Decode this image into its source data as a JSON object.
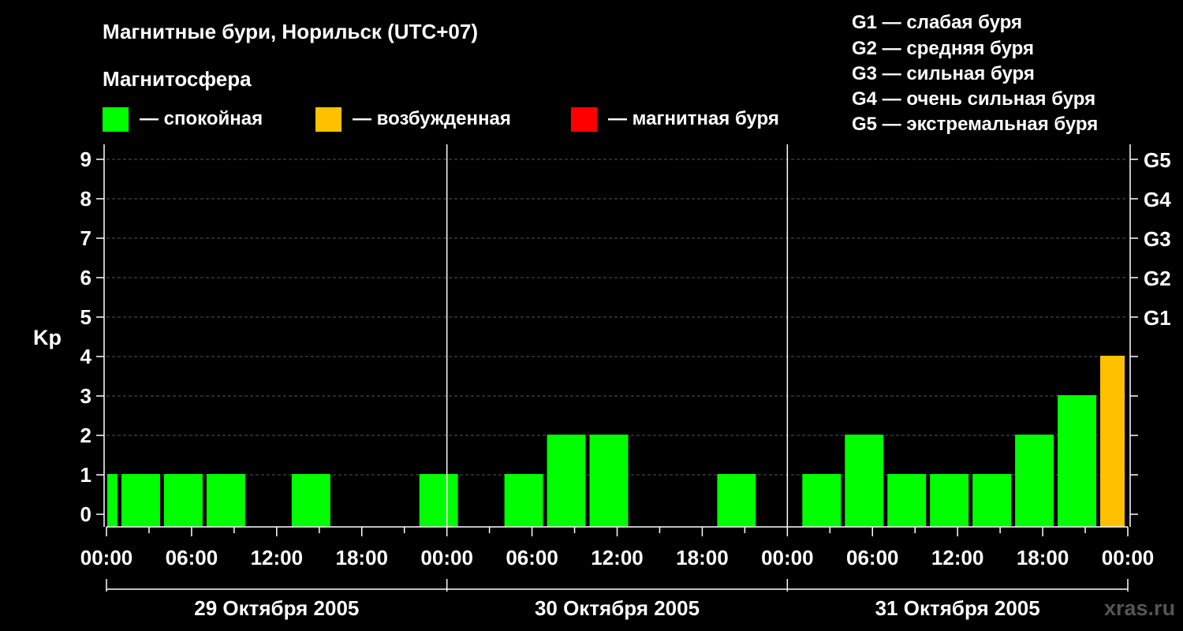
{
  "header": {
    "title": "Магнитные бури, Норильск (UTC+07)",
    "subtitle": "Магнитосфера"
  },
  "legend": {
    "items": [
      {
        "label": "— спокойная",
        "color": "#00ff00"
      },
      {
        "label": "— возбужденная",
        "color": "#ffc000"
      },
      {
        "label": "— магнитная буря",
        "color": "#ff0000"
      }
    ]
  },
  "g_legend": [
    "G1 — слабая буря",
    "G2 — средняя буря",
    "G3 — сильная буря",
    "G4 — очень сильная буря",
    "G5 — экстремальная буря"
  ],
  "watermark": "xras.ru",
  "colors": {
    "quiet": "#00ff00",
    "disturbed": "#ffc000",
    "storm": "#ff0000",
    "background": "#000000",
    "grid": "#555555"
  },
  "chart_data": {
    "type": "bar",
    "ylabel": "Kp",
    "ylim": [
      0,
      9
    ],
    "yticks": [
      "0",
      "1",
      "2",
      "3",
      "4",
      "5",
      "6",
      "7",
      "8",
      "9"
    ],
    "g_ticks": [
      {
        "kp": 5,
        "label": "G1"
      },
      {
        "kp": 6,
        "label": "G2"
      },
      {
        "kp": 7,
        "label": "G3"
      },
      {
        "kp": 8,
        "label": "G4"
      },
      {
        "kp": 9,
        "label": "G5"
      }
    ],
    "x_range_hours": [
      0,
      72
    ],
    "xticks": [
      {
        "hour": 0,
        "label": "00:00"
      },
      {
        "hour": 6,
        "label": "06:00"
      },
      {
        "hour": 12,
        "label": "12:00"
      },
      {
        "hour": 18,
        "label": "18:00"
      },
      {
        "hour": 24,
        "label": "00:00"
      },
      {
        "hour": 30,
        "label": "06:00"
      },
      {
        "hour": 36,
        "label": "12:00"
      },
      {
        "hour": 42,
        "label": "18:00"
      },
      {
        "hour": 48,
        "label": "00:00"
      },
      {
        "hour": 54,
        "label": "06:00"
      },
      {
        "hour": 60,
        "label": "12:00"
      },
      {
        "hour": 66,
        "label": "18:00"
      },
      {
        "hour": 72,
        "label": "00:00"
      }
    ],
    "days": [
      {
        "label": "29 Октября 2005",
        "start_hour": 0,
        "end_hour": 24
      },
      {
        "label": "30 Октября 2005",
        "start_hour": 24,
        "end_hour": 48
      },
      {
        "label": "31 Октября 2005",
        "start_hour": 48,
        "end_hour": 72
      }
    ],
    "bars": [
      {
        "start_hour": 0,
        "end_hour": 1,
        "kp": 1,
        "level": "quiet"
      },
      {
        "start_hour": 1,
        "end_hour": 4,
        "kp": 1,
        "level": "quiet"
      },
      {
        "start_hour": 4,
        "end_hour": 7,
        "kp": 1,
        "level": "quiet"
      },
      {
        "start_hour": 7,
        "end_hour": 10,
        "kp": 1,
        "level": "quiet"
      },
      {
        "start_hour": 13,
        "end_hour": 16,
        "kp": 1,
        "level": "quiet"
      },
      {
        "start_hour": 22,
        "end_hour": 25,
        "kp": 1,
        "level": "quiet"
      },
      {
        "start_hour": 28,
        "end_hour": 31,
        "kp": 1,
        "level": "quiet"
      },
      {
        "start_hour": 31,
        "end_hour": 34,
        "kp": 2,
        "level": "quiet"
      },
      {
        "start_hour": 34,
        "end_hour": 37,
        "kp": 2,
        "level": "quiet"
      },
      {
        "start_hour": 43,
        "end_hour": 46,
        "kp": 1,
        "level": "quiet"
      },
      {
        "start_hour": 49,
        "end_hour": 52,
        "kp": 1,
        "level": "quiet"
      },
      {
        "start_hour": 52,
        "end_hour": 55,
        "kp": 2,
        "level": "quiet"
      },
      {
        "start_hour": 55,
        "end_hour": 58,
        "kp": 1,
        "level": "quiet"
      },
      {
        "start_hour": 58,
        "end_hour": 61,
        "kp": 1,
        "level": "quiet"
      },
      {
        "start_hour": 61,
        "end_hour": 64,
        "kp": 1,
        "level": "quiet"
      },
      {
        "start_hour": 64,
        "end_hour": 67,
        "kp": 2,
        "level": "quiet"
      },
      {
        "start_hour": 67,
        "end_hour": 70,
        "kp": 3,
        "level": "quiet"
      },
      {
        "start_hour": 70,
        "end_hour": 72,
        "kp": 4,
        "level": "disturbed"
      }
    ]
  }
}
